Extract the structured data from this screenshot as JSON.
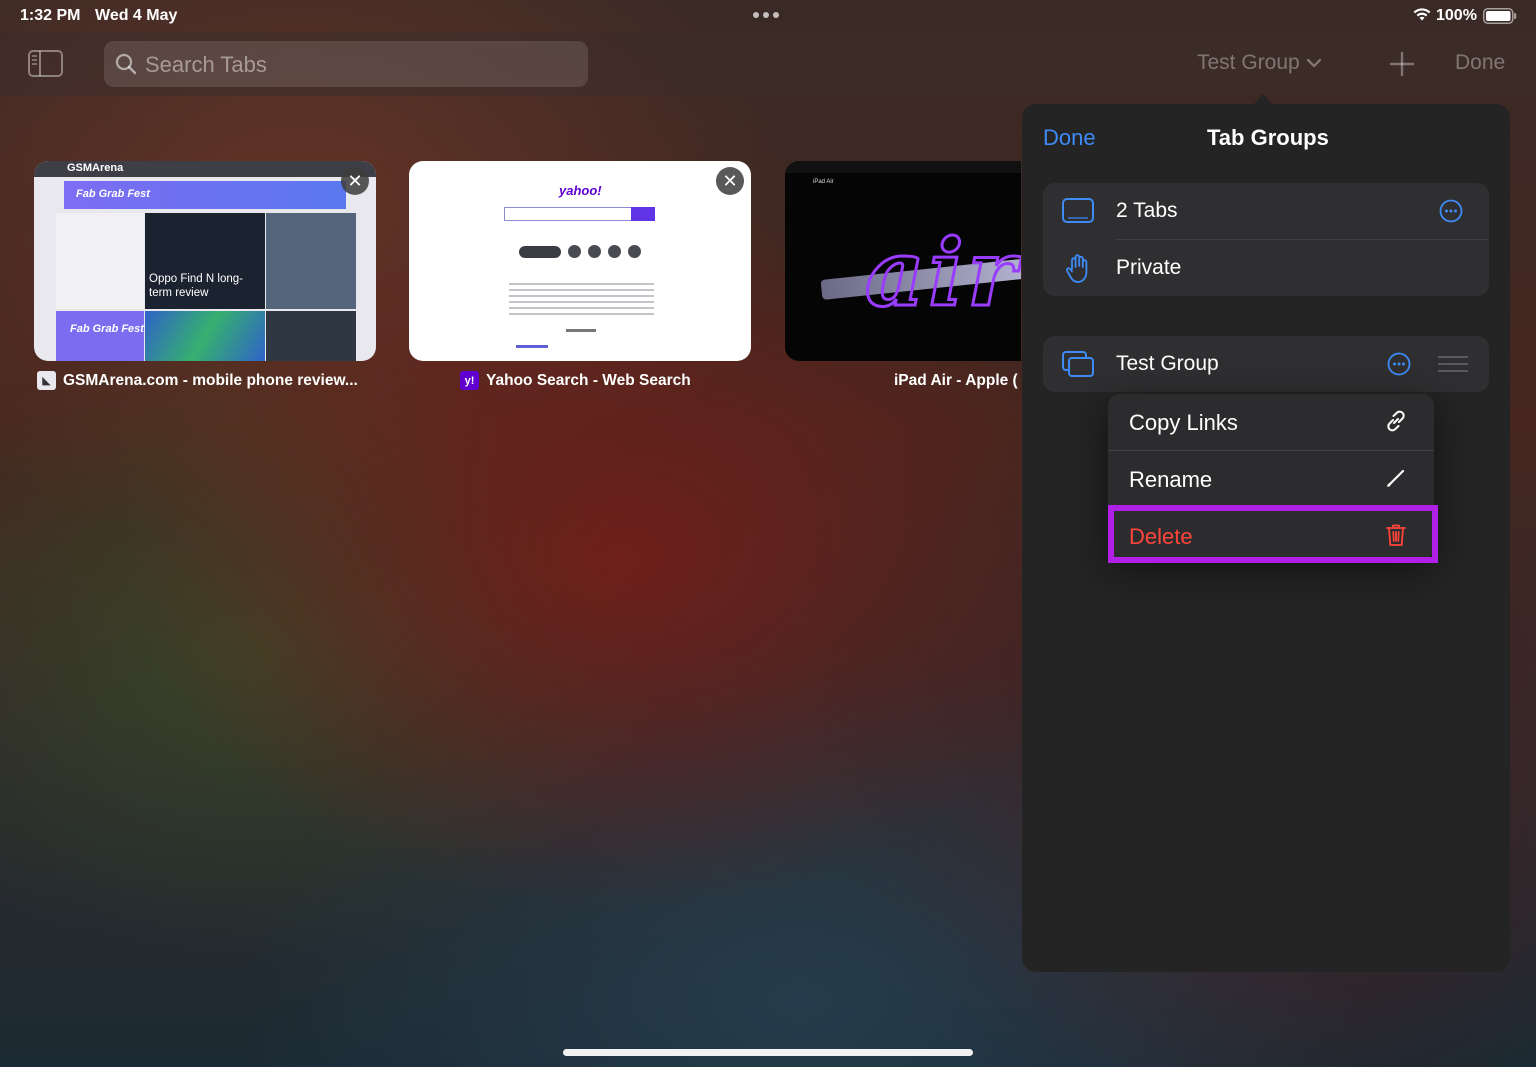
{
  "status": {
    "time": "1:32 PM",
    "date": "Wed 4 May",
    "battery": "100%"
  },
  "toolbar": {
    "search_placeholder": "Search Tabs",
    "group_title": "Test Group",
    "done": "Done"
  },
  "tabs": [
    {
      "title": "GSMArena.com - mobile phone review...",
      "thumb_header": "GSMArena",
      "thumb_banner": "Fab Grab Fest",
      "thumb_caption": "Oppo Find N long-term review",
      "thumb_small": "Fab Grab Fest"
    },
    {
      "title": "Yahoo Search - Web Search",
      "thumb_logo": "yahoo!"
    },
    {
      "title": "iPad Air - Apple (",
      "thumb_sub": "iPad Air",
      "thumb_word": "air"
    }
  ],
  "panel": {
    "done": "Done",
    "title": "Tab Groups",
    "rows": [
      {
        "label": "2 Tabs"
      },
      {
        "label": "Private"
      }
    ],
    "group": {
      "label": "Test Group"
    }
  },
  "menu": {
    "items": [
      {
        "label": "Copy Links",
        "icon": "link-icon"
      },
      {
        "label": "Rename",
        "icon": "pencil-icon"
      },
      {
        "label": "Delete",
        "icon": "trash-icon"
      }
    ]
  },
  "colors": {
    "accent": "#3e8bf5",
    "destructive": "#ff453a",
    "highlight": "#b020e6"
  }
}
